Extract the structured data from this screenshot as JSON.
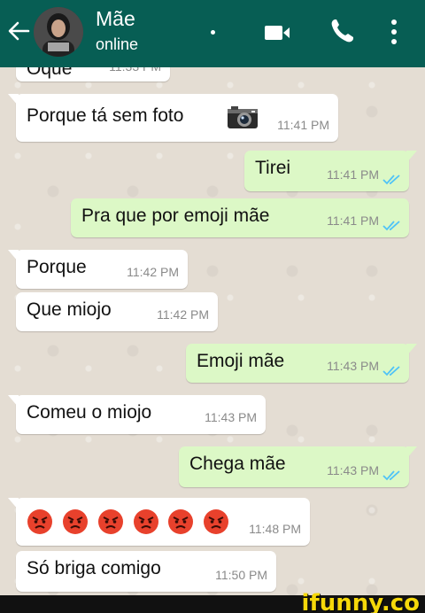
{
  "header": {
    "contact_name": "Mãe",
    "contact_status": "online",
    "bg_color": "#075e54"
  },
  "messages": [
    {
      "dir": "in",
      "text": "Oque",
      "time": "11:33 PM"
    },
    {
      "dir": "in",
      "text": "Porque tá sem foto",
      "icon": "camera-emoji",
      "time": "11:41 PM"
    },
    {
      "dir": "out",
      "text": "Tirei",
      "time": "11:41 PM",
      "status": "read"
    },
    {
      "dir": "out",
      "text": "Pra que por emoji mãe",
      "time": "11:41 PM",
      "status": "read"
    },
    {
      "dir": "in",
      "text": "Porque",
      "time": "11:42 PM"
    },
    {
      "dir": "in",
      "text": "Que miojo",
      "time": "11:42 PM"
    },
    {
      "dir": "out",
      "text": "Emoji mãe",
      "time": "11:43 PM",
      "status": "read"
    },
    {
      "dir": "in",
      "text": "Comeu o miojo",
      "time": "11:43 PM"
    },
    {
      "dir": "out",
      "text": "Chega mãe",
      "time": "11:43 PM",
      "status": "read"
    },
    {
      "dir": "in",
      "emojis": [
        "angry-face",
        "angry-face",
        "angry-face",
        "angry-face",
        "angry-face",
        "angry-face"
      ],
      "time": "11:48 PM"
    },
    {
      "dir": "in",
      "text": "Só briga comigo",
      "time": "11:50 PM"
    }
  ],
  "colors": {
    "incoming": "#ffffff",
    "outgoing": "#dcf8c6",
    "read_ticks": "#4fc3f7"
  },
  "watermark": "ifunny.co"
}
